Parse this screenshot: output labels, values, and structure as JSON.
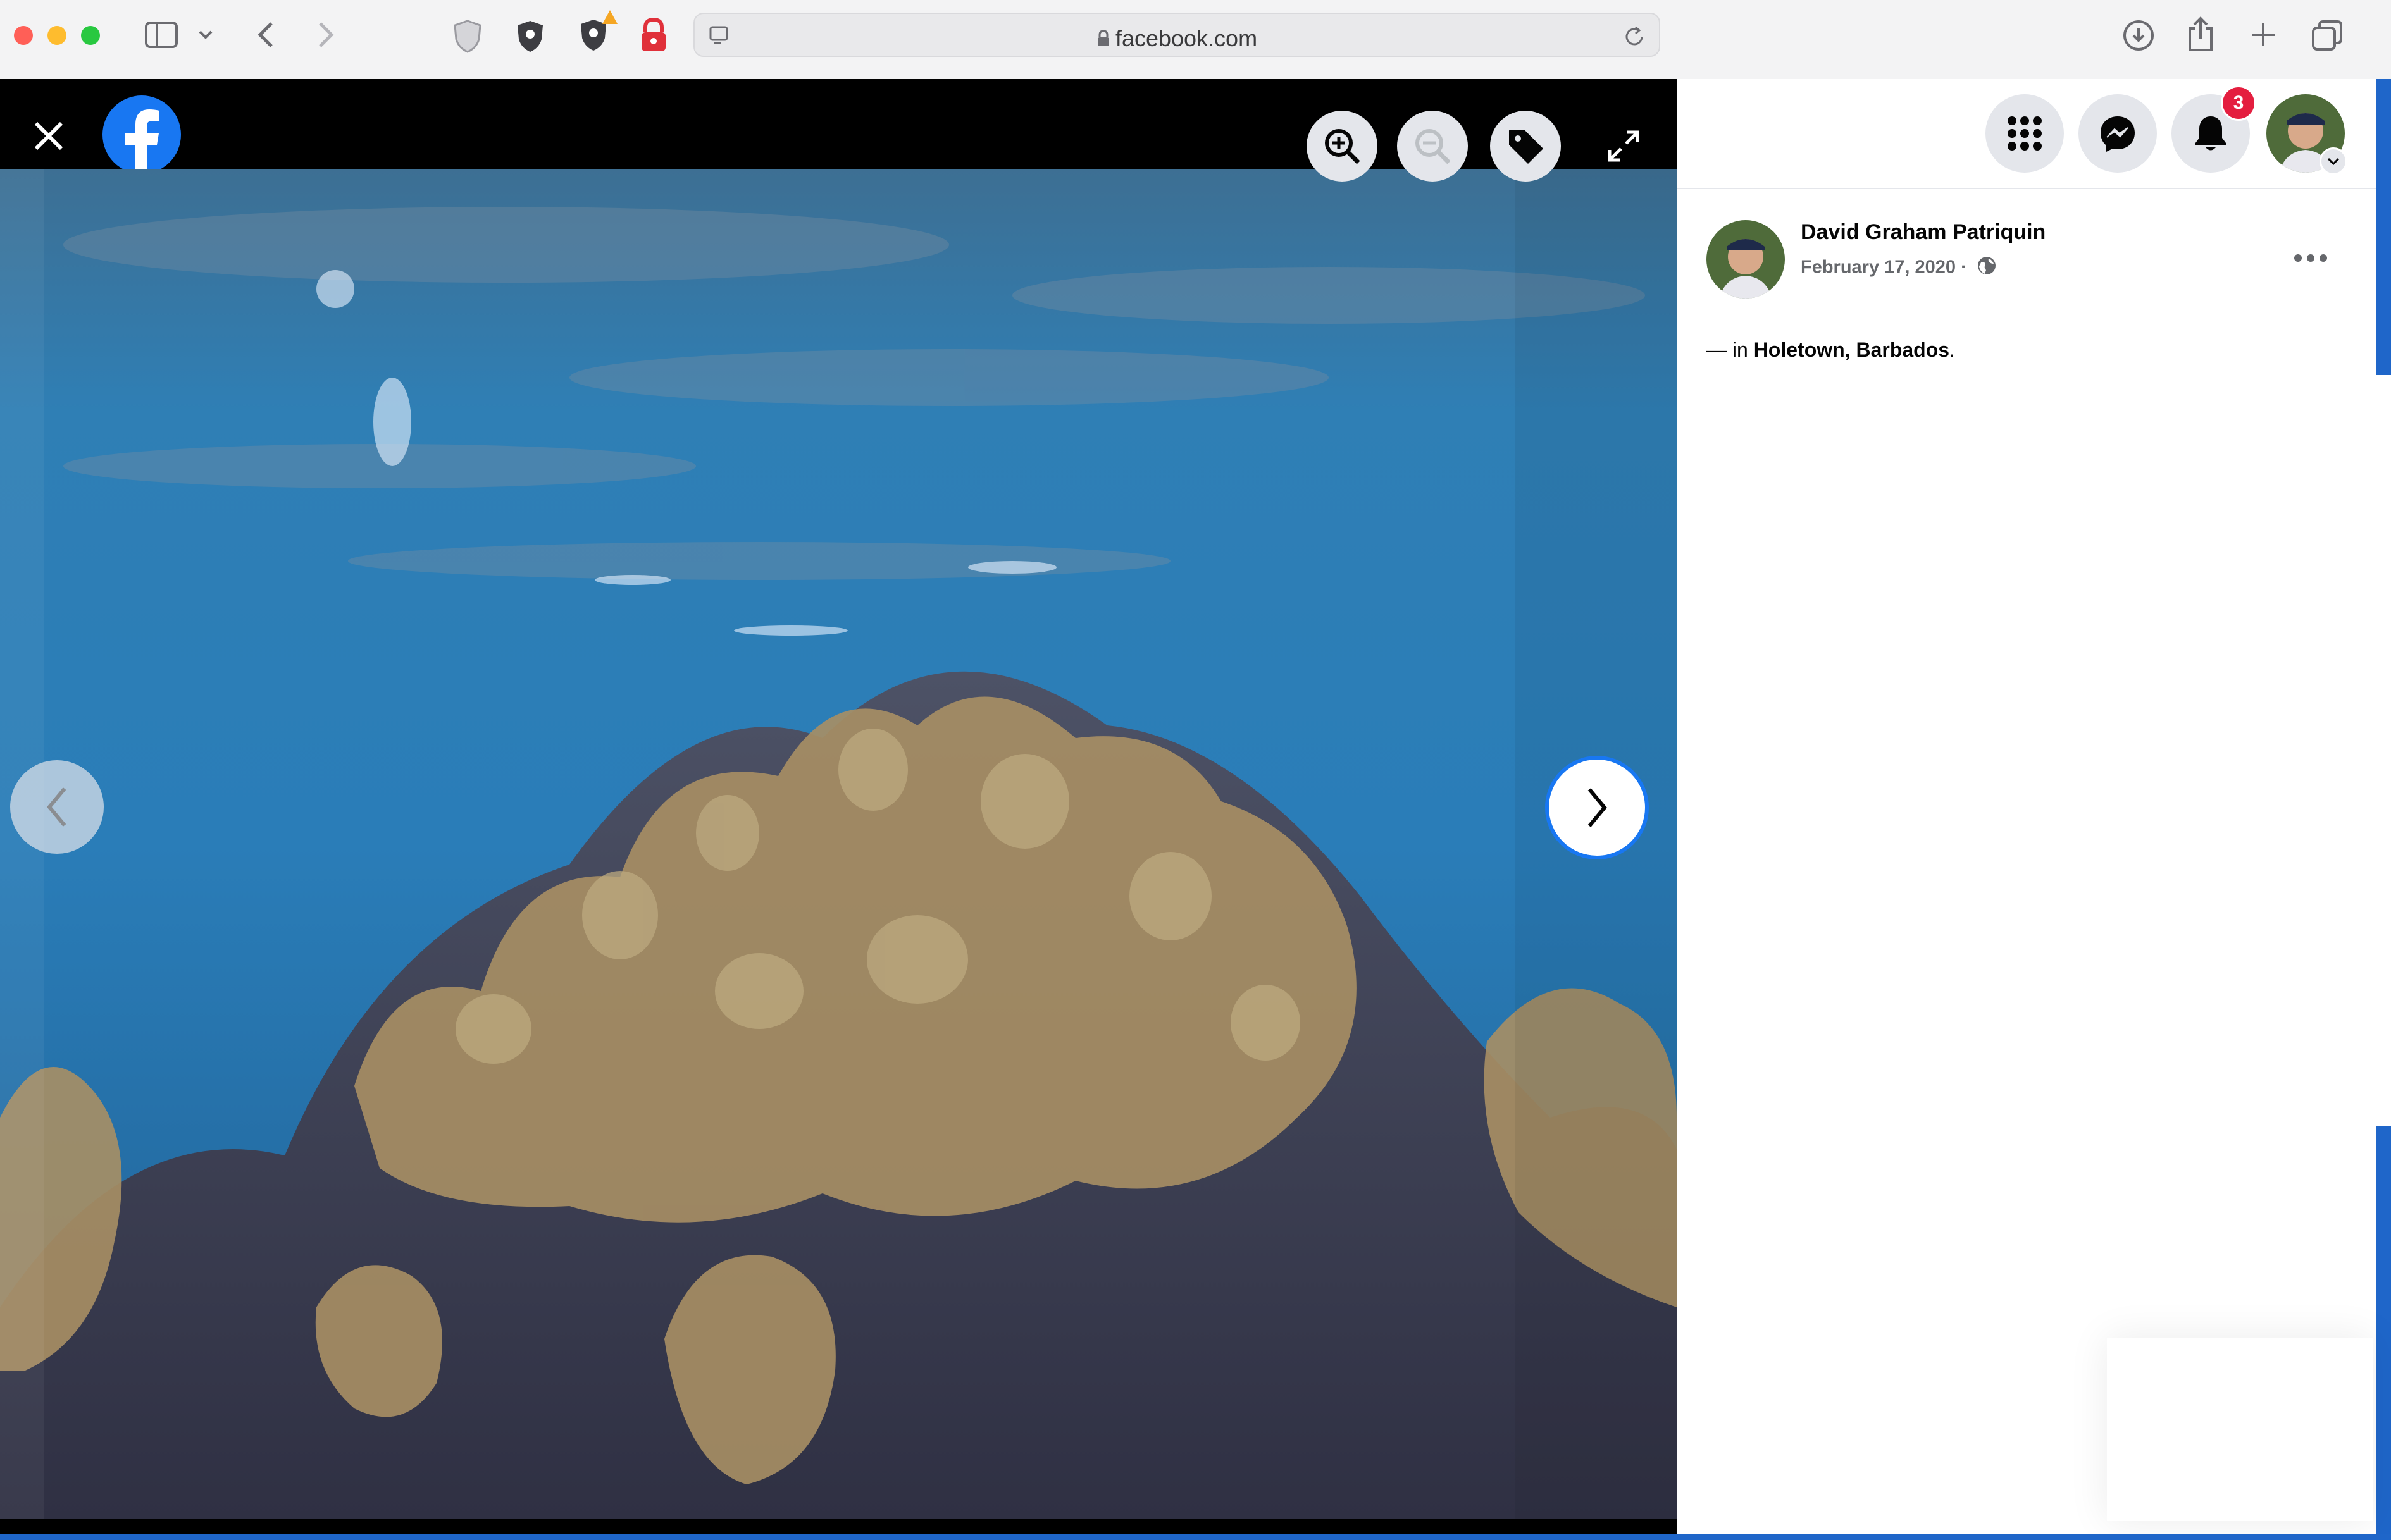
{
  "browser": {
    "url": "facebook.com",
    "icons": [
      "sidebar-toggle-icon",
      "chevron-down-icon",
      "back-icon",
      "forward-icon",
      "shield-icon",
      "privacy-icon",
      "lock-icon",
      "reader-icon",
      "reload-icon",
      "download-icon",
      "share-icon",
      "new-tab-icon",
      "tabs-overview-icon"
    ]
  },
  "viewer": {
    "tools": [
      "zoom-in-icon",
      "zoom-out-icon",
      "tag-icon",
      "fullscreen-icon"
    ],
    "photo_subject": "underwater coral reef"
  },
  "header": {
    "notification_count": "3"
  },
  "post": {
    "author": "David Graham Patriquin",
    "date": "February 17, 2020 ·",
    "location_prefix": "— in ",
    "location_name": "Holetown, Barbados",
    "location_suffix": "."
  },
  "colors": {
    "facebook_blue": "#1877f2",
    "badge_red": "#e41e3f",
    "button_gray": "#e4e6eb"
  }
}
